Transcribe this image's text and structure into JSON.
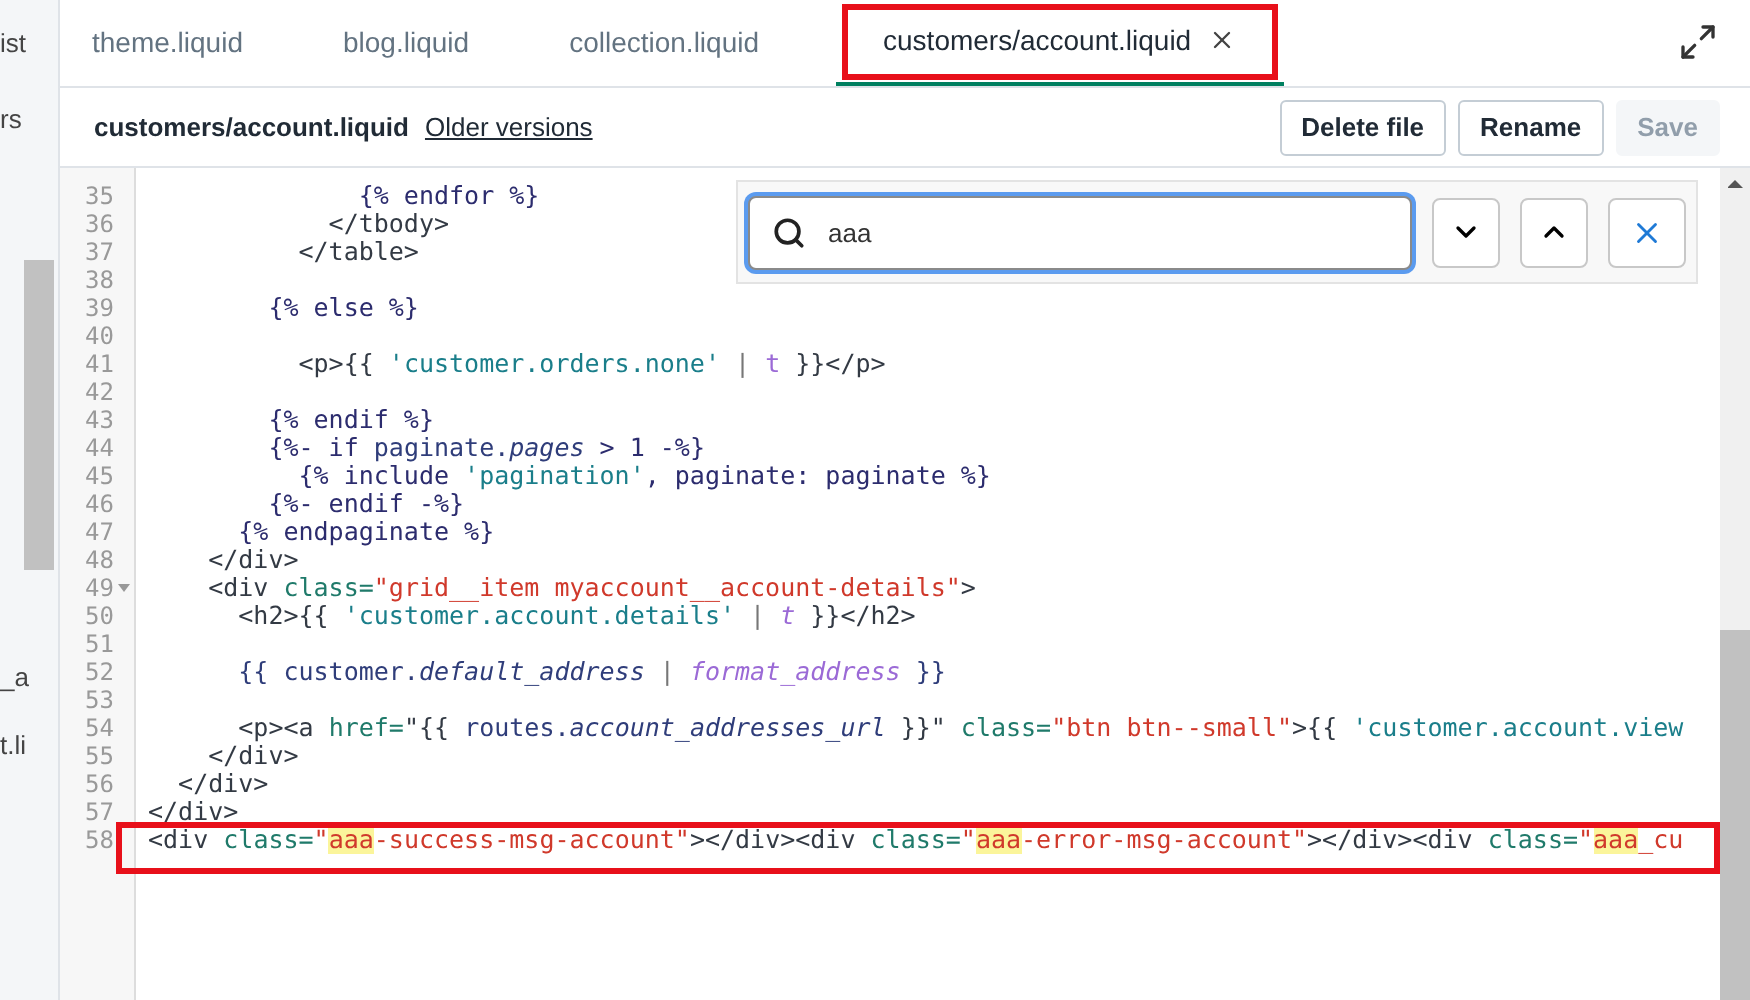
{
  "sidebar": {
    "items": [
      "ist",
      "rs",
      "_a",
      "t.li"
    ]
  },
  "tabs": [
    {
      "label": "theme.liquid",
      "selected": false,
      "annotated": false
    },
    {
      "label": "blog.liquid",
      "selected": false,
      "annotated": false
    },
    {
      "label": "collection.liquid",
      "selected": false,
      "annotated": false
    },
    {
      "label": "customers/account.liquid",
      "selected": true,
      "annotated": true
    }
  ],
  "file_header": {
    "title": "customers/account.liquid",
    "link": "Older versions",
    "buttons": [
      {
        "label": "Delete file",
        "disabled": false
      },
      {
        "label": "Rename",
        "disabled": false
      },
      {
        "label": "Save",
        "disabled": true
      }
    ]
  },
  "search": {
    "value": "aaa"
  },
  "code": {
    "lines": [
      {
        "number": "35",
        "fold": false,
        "annotated": false,
        "segments": [
          {
            "text": "              {% endfor %}",
            "kind": "liquid"
          }
        ]
      },
      {
        "number": "36",
        "fold": false,
        "annotated": false,
        "segments": [
          {
            "text": "            </tbody>",
            "kind": "tag"
          }
        ]
      },
      {
        "number": "37",
        "fold": false,
        "annotated": false,
        "segments": [
          {
            "text": "          </table>",
            "kind": "tag"
          }
        ]
      },
      {
        "number": "38",
        "fold": false,
        "annotated": false
      },
      {
        "number": "39",
        "fold": false,
        "annotated": false,
        "segments": [
          {
            "text": "        {% else %}",
            "kind": "liquid"
          }
        ]
      },
      {
        "number": "40",
        "fold": false,
        "annotated": false
      },
      {
        "number": "41",
        "fold": false,
        "annotated": false,
        "segments": [
          {
            "text": "          <p>{{ ",
            "kind": "tag"
          },
          {
            "text": "'customer.orders.none'",
            "kind": "literal"
          },
          {
            "text": " | ",
            "kind": "plain"
          },
          {
            "text": "t",
            "kind": "filter"
          },
          {
            "text": " }}</p>",
            "kind": "tag"
          }
        ]
      },
      {
        "number": "42",
        "fold": false,
        "annotated": false
      },
      {
        "number": "43",
        "fold": false,
        "annotated": false,
        "segments": [
          {
            "text": "        {% endif %}",
            "kind": "liquid"
          }
        ]
      },
      {
        "number": "44",
        "fold": false,
        "annotated": false,
        "segments": [
          {
            "text": "        {%- if ",
            "kind": "liquid"
          },
          {
            "text": "paginate.",
            "kind": "variable"
          },
          {
            "text": "pages",
            "kind": "property"
          },
          {
            "text": " > 1 -%}",
            "kind": "liquid"
          }
        ]
      },
      {
        "number": "45",
        "fold": false,
        "annotated": false,
        "segments": [
          {
            "text": "          {% include ",
            "kind": "liquid"
          },
          {
            "text": "'pagination'",
            "kind": "literal"
          },
          {
            "text": ", paginate: paginate %}",
            "kind": "liquid"
          }
        ]
      },
      {
        "number": "46",
        "fold": false,
        "annotated": false,
        "segments": [
          {
            "text": "        {%- endif -%}",
            "kind": "liquid"
          }
        ]
      },
      {
        "number": "47",
        "fold": false,
        "annotated": false,
        "segments": [
          {
            "text": "      {% endpaginate %}",
            "kind": "liquid"
          }
        ]
      },
      {
        "number": "48",
        "fold": false,
        "annotated": false,
        "segments": [
          {
            "text": "    </div>",
            "kind": "tag"
          }
        ]
      },
      {
        "number": "49",
        "fold": true,
        "annotated": false,
        "segments": [
          {
            "text": "    <div ",
            "kind": "tag"
          },
          {
            "text": "class=",
            "kind": "attribute"
          },
          {
            "text": "\"grid__item myaccount__account-details\"",
            "kind": "string"
          },
          {
            "text": ">",
            "kind": "tag"
          }
        ]
      },
      {
        "number": "50",
        "fold": false,
        "annotated": false,
        "segments": [
          {
            "text": "      <h2>{{ ",
            "kind": "tag"
          },
          {
            "text": "'customer.account.details'",
            "kind": "literal"
          },
          {
            "text": " | ",
            "kind": "plain"
          },
          {
            "text": "t",
            "kind": "function"
          },
          {
            "text": " }}</h2>",
            "kind": "tag"
          }
        ]
      },
      {
        "number": "51",
        "fold": false,
        "annotated": false
      },
      {
        "number": "52",
        "fold": false,
        "annotated": false,
        "segments": [
          {
            "text": "      {{ customer.",
            "kind": "variable"
          },
          {
            "text": "default_address",
            "kind": "property"
          },
          {
            "text": " | ",
            "kind": "plain"
          },
          {
            "text": "format_address",
            "kind": "function"
          },
          {
            "text": " }}",
            "kind": "variable"
          }
        ]
      },
      {
        "number": "53",
        "fold": false,
        "annotated": false
      },
      {
        "number": "54",
        "fold": false,
        "annotated": false,
        "segments": [
          {
            "text": "      <p><a ",
            "kind": "tag"
          },
          {
            "text": "href=",
            "kind": "attribute"
          },
          {
            "text": "\"{{ ",
            "kind": "tag"
          },
          {
            "text": "routes.",
            "kind": "variable"
          },
          {
            "text": "account_addresses_url",
            "kind": "property"
          },
          {
            "text": " }}\"",
            "kind": "tag"
          },
          {
            "text": " class=",
            "kind": "attribute"
          },
          {
            "text": "\"btn btn--small\"",
            "kind": "string"
          },
          {
            "text": ">{{ ",
            "kind": "tag"
          },
          {
            "text": "'customer.account.view",
            "kind": "literal"
          }
        ]
      },
      {
        "number": "55",
        "fold": false,
        "annotated": false,
        "segments": [
          {
            "text": "    </div>",
            "kind": "tag"
          }
        ]
      },
      {
        "number": "56",
        "fold": false,
        "annotated": false,
        "segments": [
          {
            "text": "  </div>",
            "kind": "tag"
          }
        ]
      },
      {
        "number": "57",
        "fold": false,
        "annotated": false,
        "segments": [
          {
            "text": "</div>",
            "kind": "tag"
          }
        ]
      },
      {
        "number": "58",
        "fold": false,
        "annotated": true,
        "segments": [
          {
            "text": "<div ",
            "kind": "tag"
          },
          {
            "text": "class=",
            "kind": "attribute"
          },
          {
            "text": "\"",
            "kind": "string"
          },
          {
            "text": "aaa",
            "kind": "match"
          },
          {
            "text": "-success-msg-account\"",
            "kind": "string"
          },
          {
            "text": "></div><div ",
            "kind": "tag"
          },
          {
            "text": "class=",
            "kind": "attribute"
          },
          {
            "text": "\"",
            "kind": "string"
          },
          {
            "text": "aaa",
            "kind": "match"
          },
          {
            "text": "-error-msg-account\"",
            "kind": "string"
          },
          {
            "text": "></div><div ",
            "kind": "tag"
          },
          {
            "text": "class=",
            "kind": "attribute"
          },
          {
            "text": "\"",
            "kind": "string"
          },
          {
            "text": "aaa",
            "kind": "match"
          },
          {
            "text": "_cu",
            "kind": "string"
          }
        ]
      }
    ]
  }
}
